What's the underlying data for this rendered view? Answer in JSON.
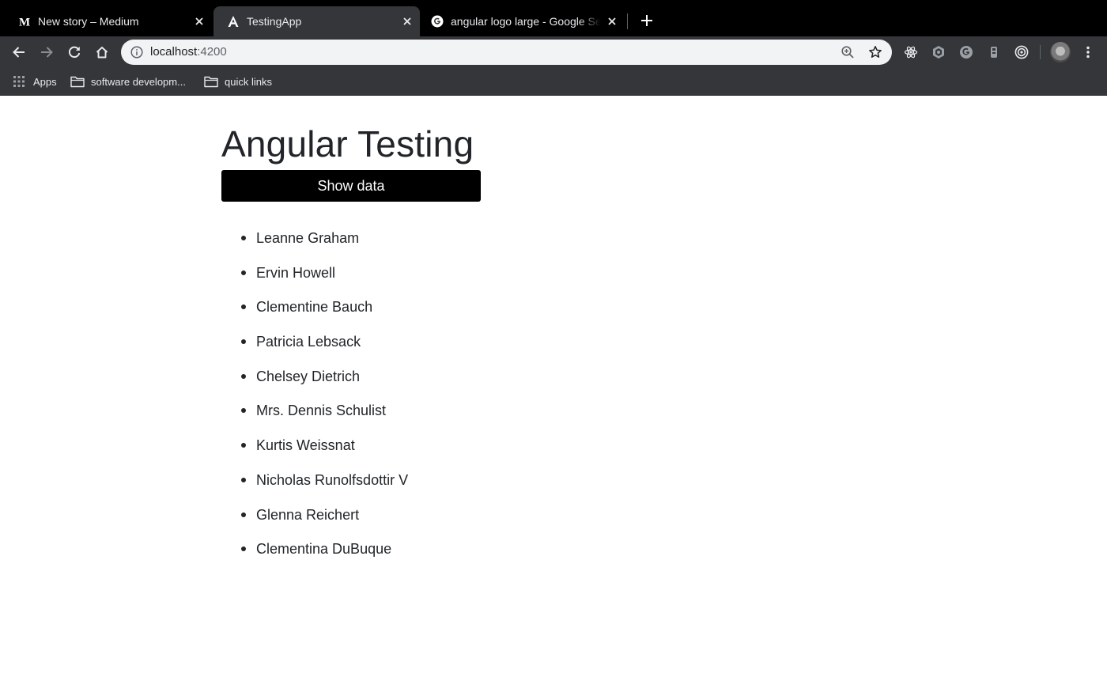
{
  "browser": {
    "tabs": [
      {
        "title": "New story – Medium",
        "favicon": "medium-icon",
        "active": false
      },
      {
        "title": "TestingApp",
        "favicon": "angular-icon",
        "active": true
      },
      {
        "title": "angular logo large - Google Search",
        "favicon": "google-icon",
        "active": false
      }
    ],
    "address": {
      "host": "localhost",
      "port": ":4200"
    },
    "bookmarks": [
      {
        "label": "Apps",
        "icon": "apps-grid-icon"
      },
      {
        "label": "software developm...",
        "icon": "folder-icon"
      },
      {
        "label": "quick links",
        "icon": "folder-icon"
      }
    ],
    "colors": {
      "tabstrip": "#000000",
      "toolbar": "#35363a",
      "omnibox": "#f1f3f4"
    }
  },
  "app": {
    "heading": "Angular Testing",
    "show_button": "Show data",
    "users": [
      "Leanne Graham",
      "Ervin Howell",
      "Clementine Bauch",
      "Patricia Lebsack",
      "Chelsey Dietrich",
      "Mrs. Dennis Schulist",
      "Kurtis Weissnat",
      "Nicholas Runolfsdottir V",
      "Glenna Reichert",
      "Clementina DuBuque"
    ],
    "colors": {
      "button_bg": "#000000",
      "button_text": "#ffffff",
      "text": "#212529"
    }
  }
}
